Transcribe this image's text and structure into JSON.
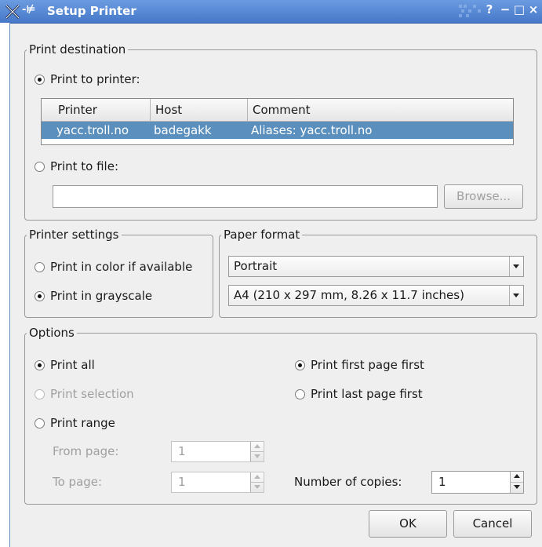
{
  "window": {
    "title": "Setup Printer",
    "controls": {
      "help": "?",
      "minimize": "−",
      "maximize": "□",
      "close": "×"
    }
  },
  "print_destination": {
    "legend": "Print destination",
    "print_to_printer": {
      "label": "Print to printer:",
      "selected": true
    },
    "printer_table": {
      "columns": [
        "Printer",
        "Host",
        "Comment"
      ],
      "rows": [
        {
          "printer": "yacc.troll.no",
          "host": "badegakk",
          "comment": "Aliases: yacc.troll.no",
          "selected": true
        }
      ]
    },
    "print_to_file": {
      "label": "Print to file:",
      "selected": false
    },
    "file_path": {
      "value": ""
    },
    "browse_label": "Browse..."
  },
  "printer_settings": {
    "legend": "Printer settings",
    "color_label": "Print in color if available",
    "grayscale_label": "Print in grayscale",
    "selected": "grayscale"
  },
  "paper_format": {
    "legend": "Paper format",
    "orientation": "Portrait",
    "size": "A4 (210 x 297 mm, 8.26 x 11.7 inches)"
  },
  "options": {
    "legend": "Options",
    "print_all": "Print all",
    "print_selection": "Print selection",
    "print_range": "Print range",
    "from_page_label": "From page:",
    "from_page_value": "1",
    "to_page_label": "To page:",
    "to_page_value": "1",
    "print_first_page_first": "Print first page first",
    "print_last_page_first": "Print last page first",
    "copies_label": "Number of copies:",
    "copies_value": "1"
  },
  "buttons": {
    "ok": "OK",
    "cancel": "Cancel"
  },
  "colors": {
    "titlebar": "#4678c8",
    "selection": "#5b8fbd",
    "dialog_bg": "#efefef"
  }
}
